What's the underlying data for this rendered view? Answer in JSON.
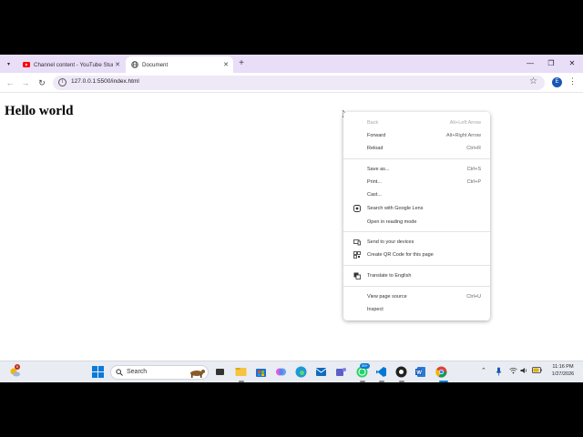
{
  "browser": {
    "tabs": [
      {
        "title": "Channel content - YouTube Studio",
        "active": false
      },
      {
        "title": "Document",
        "active": true
      }
    ],
    "url": "127.0.0.1:5500/index.html",
    "profile_initial": "E"
  },
  "page": {
    "heading": "Hello world"
  },
  "context_menu": {
    "items": [
      {
        "label": "Back",
        "shortcut": "Alt+Left Arrow",
        "disabled": true
      },
      {
        "label": "Forward",
        "shortcut": "Alt+Right Arrow",
        "disabled": false
      },
      {
        "label": "Reload",
        "shortcut": "Ctrl+R",
        "disabled": false
      },
      {
        "label": "Save as...",
        "shortcut": "Ctrl+S",
        "disabled": false
      },
      {
        "label": "Print...",
        "shortcut": "Ctrl+P",
        "disabled": false
      },
      {
        "label": "Cast...",
        "shortcut": "",
        "disabled": false
      },
      {
        "label": "Search with Google Lens",
        "shortcut": "",
        "icon": "lens-icon"
      },
      {
        "label": "Open in reading mode",
        "shortcut": ""
      },
      {
        "label": "Send to your devices",
        "shortcut": "",
        "icon": "devices-icon"
      },
      {
        "label": "Create QR Code for this page",
        "shortcut": "",
        "icon": "qr-code-icon"
      },
      {
        "label": "Translate to English",
        "shortcut": "",
        "icon": "translate-icon"
      },
      {
        "label": "View page source",
        "shortcut": "Ctrl+U"
      },
      {
        "label": "Inspect",
        "shortcut": ""
      }
    ]
  },
  "taskbar": {
    "search_label": "Search",
    "weather_badge": "6",
    "whatsapp_badge": "99+",
    "time": "11:16 PM",
    "date": "1/27/2026"
  },
  "colors": {
    "tabstrip": "#e8def8",
    "omnibox": "#efe9f7",
    "profile": "#1a56b5",
    "taskbar": "#e9ecf2"
  }
}
